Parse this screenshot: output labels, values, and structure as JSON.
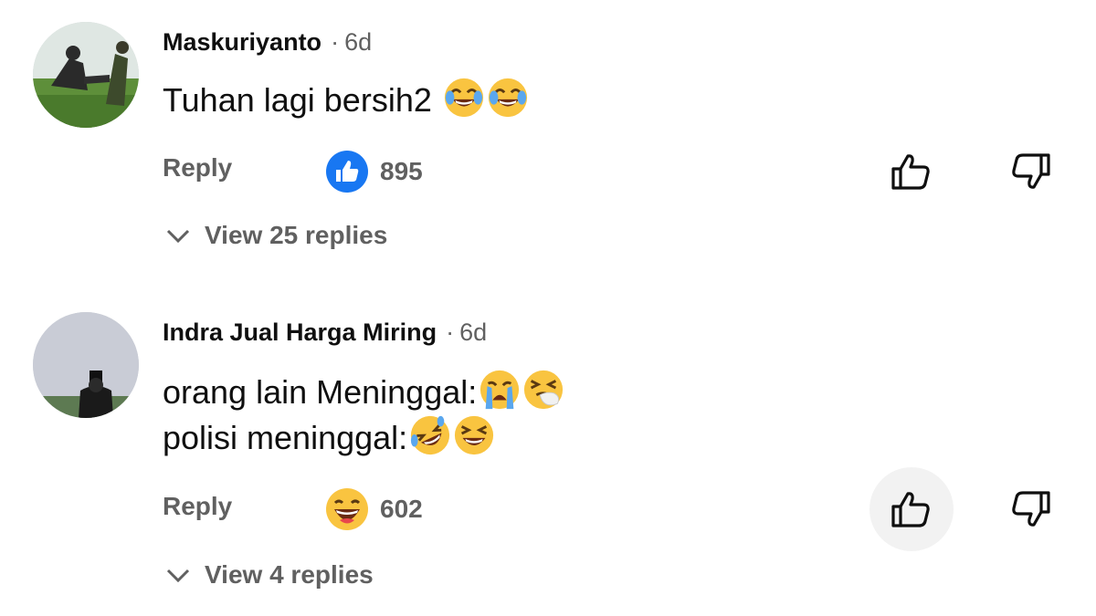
{
  "comments": [
    {
      "author": "Maskuriyanto",
      "separator": "·",
      "time": "6d",
      "lines": [
        "Tuhan lagi bersih2"
      ],
      "line_emojis": [
        [
          "face-with-tears-of-joy",
          "face-with-tears-of-joy"
        ]
      ],
      "reply_label": "Reply",
      "reaction_icon": "like-reaction-icon",
      "reaction_count": "895",
      "view_replies": "View 25 replies"
    },
    {
      "author": "Indra Jual Harga Miring",
      "separator": "·",
      "time": "6d",
      "lines": [
        "orang lain Meninggal:",
        "polisi meninggal:"
      ],
      "line_emojis": [
        [
          "loudly-crying-face",
          "sneezing-face"
        ],
        [
          "rolling-on-floor-laughing",
          "grinning-squinting-face"
        ]
      ],
      "reply_label": "Reply",
      "reaction_icon": "haha-reaction-icon",
      "reaction_count": "602",
      "view_replies": "View 4 replies"
    }
  ],
  "colors": {
    "text_primary": "#0f0f0f",
    "text_secondary": "#606060",
    "like_blue": "#1877f2",
    "emoji_yellow": "#f9c440",
    "active_button_bg": "#f2f2f2"
  }
}
